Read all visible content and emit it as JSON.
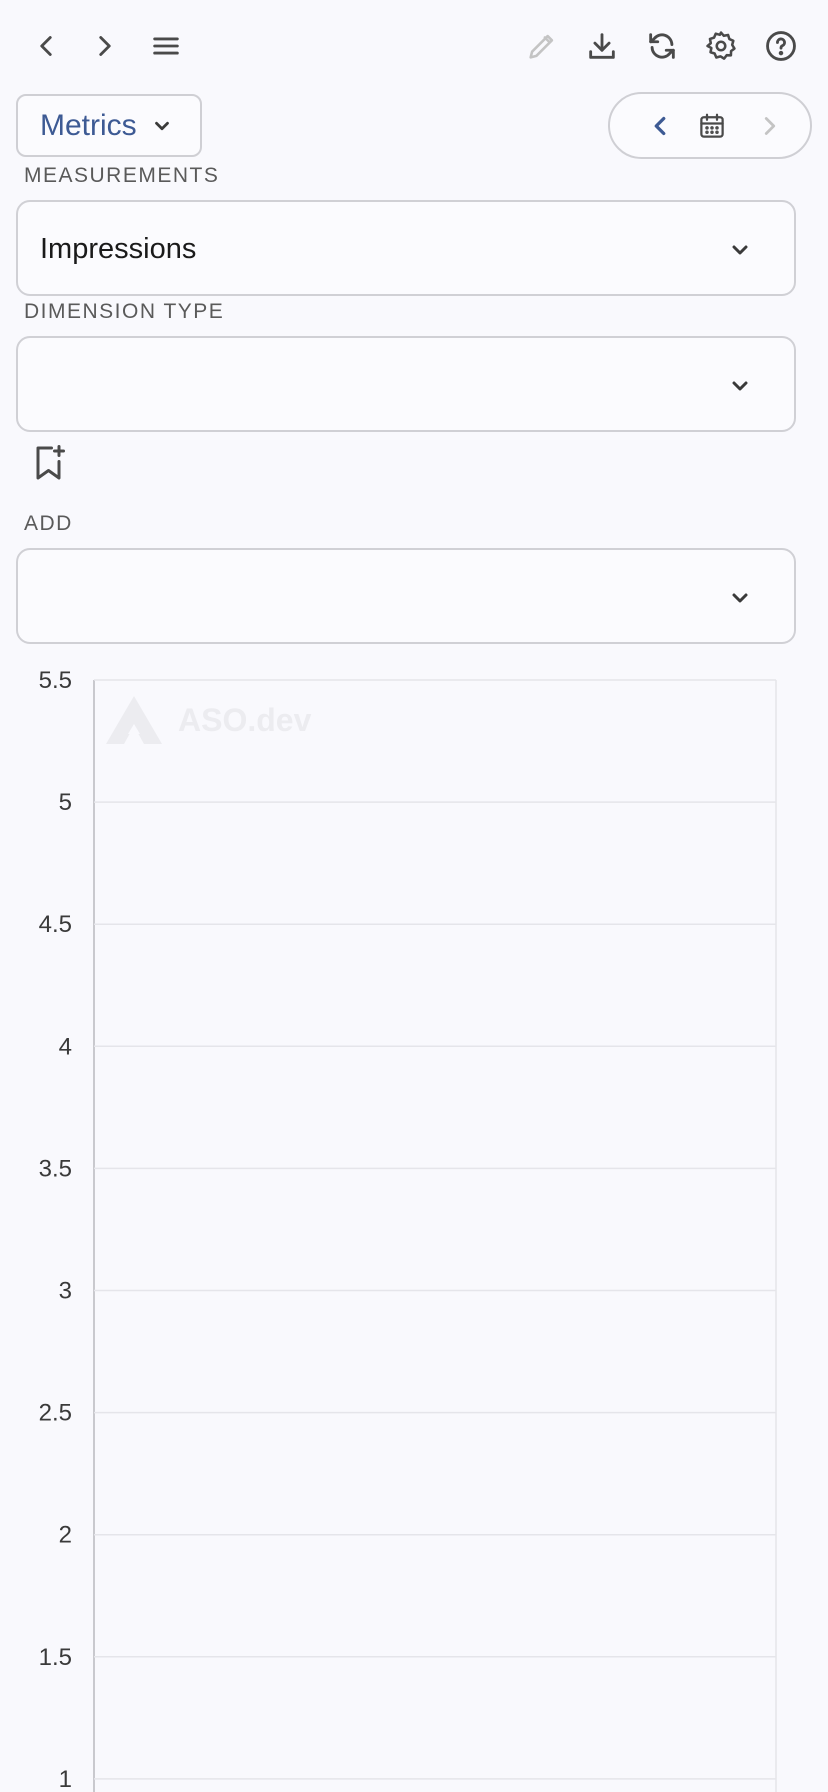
{
  "toolbar": {
    "icons": [
      "chevron-left-icon",
      "chevron-right-icon",
      "menu-icon",
      "pencil-icon",
      "download-icon",
      "refresh-icon",
      "gear-icon",
      "help-icon"
    ]
  },
  "metrics_button": {
    "label": "Metrics"
  },
  "filters": {
    "measurements": {
      "label": "MEASUREMENTS",
      "value": "Impressions"
    },
    "dimension_type": {
      "label": "DIMENSION TYPE",
      "value": ""
    },
    "add": {
      "label": "ADD",
      "value": ""
    }
  },
  "watermark": {
    "text": "ASO.dev"
  },
  "colors": {
    "accent": "#3d5a94",
    "background": "#f9f9fd",
    "border": "#cfcfd4",
    "grid": "#e5e5ea"
  },
  "chart_data": {
    "type": "line",
    "title": "",
    "xlabel": "",
    "ylabel": "",
    "ylim": [
      1,
      5.5
    ],
    "yticks": [
      "5.5",
      "5",
      "4.5",
      "4",
      "3.5",
      "3",
      "2.5",
      "2",
      "1.5",
      "1"
    ],
    "series": [],
    "grid": true
  }
}
